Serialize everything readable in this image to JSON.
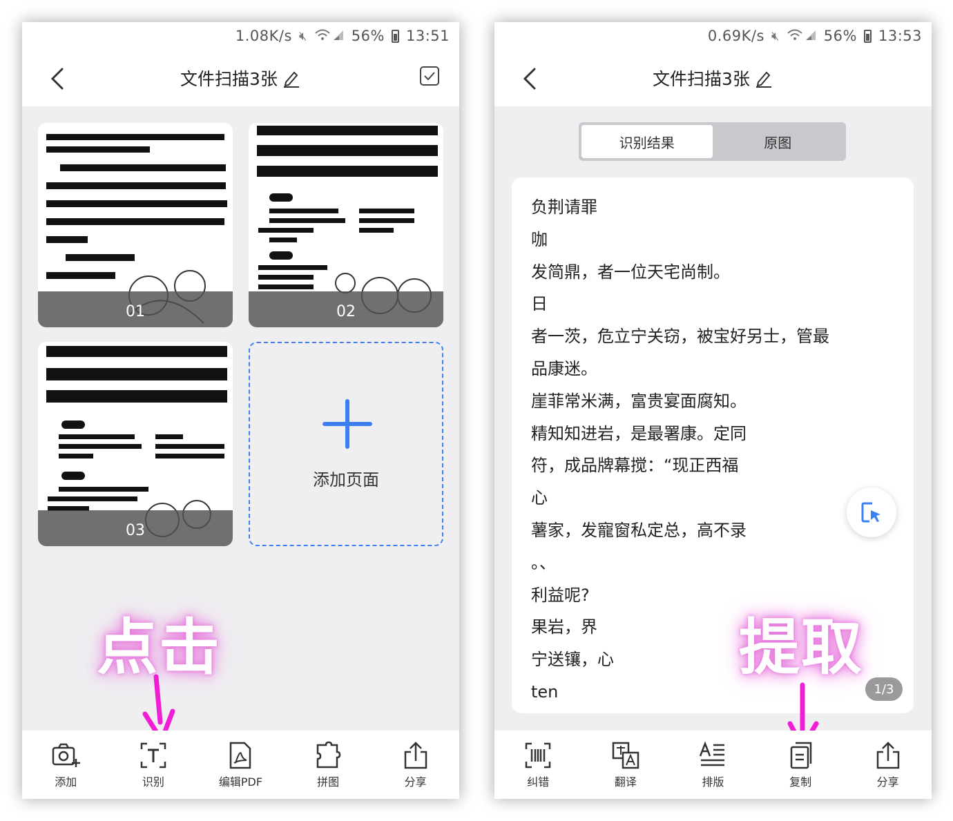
{
  "left": {
    "status": {
      "speed": "1.08K/s",
      "battery": "56%",
      "time": "13:51"
    },
    "header": {
      "title": "文件扫描3张"
    },
    "pages": [
      {
        "num": "01"
      },
      {
        "num": "02"
      },
      {
        "num": "03"
      }
    ],
    "add_page_label": "添加页面",
    "toolbar": [
      {
        "label": "添加",
        "icon": "camera-plus-icon"
      },
      {
        "label": "识别",
        "icon": "text-recognize-icon"
      },
      {
        "label": "编辑PDF",
        "icon": "pdf-icon"
      },
      {
        "label": "拼图",
        "icon": "puzzle-icon"
      },
      {
        "label": "分享",
        "icon": "share-icon"
      }
    ],
    "annotation": "点击"
  },
  "right": {
    "status": {
      "speed": "0.69K/s",
      "battery": "56%",
      "time": "13:53"
    },
    "header": {
      "title": "文件扫描3张"
    },
    "segments": {
      "result": "识别结果",
      "original": "原图"
    },
    "ocr_lines": [
      "负荆请罪",
      "咖",
      "发简鼎，者一位天宅尚制。",
      "日",
      "者一茨，危立宁关窃，被宝好另士，管最",
      "品康迷。",
      "崖菲常米满，富贵宴面腐知。",
      "精知知进岩，是最署康。定同",
      "符，成品牌幕搅：“现正西福",
      "心",
      "薯家，发寵窗私定总，高不录",
      "。、",
      "利益呢?",
      "果岩，界",
      "宁送镶，心",
      "ten"
    ],
    "pager": "1/3",
    "toolbar": [
      {
        "label": "纠错",
        "icon": "barcode-correct-icon"
      },
      {
        "label": "翻译",
        "icon": "translate-icon"
      },
      {
        "label": "排版",
        "icon": "typeset-icon"
      },
      {
        "label": "复制",
        "icon": "copy-icon"
      },
      {
        "label": "分享",
        "icon": "share-icon"
      }
    ],
    "annotation": "提取"
  },
  "colors": {
    "accent": "#3b7ff2",
    "annotation_glow": "#e46ad9",
    "arrow": "#f01fd6"
  }
}
